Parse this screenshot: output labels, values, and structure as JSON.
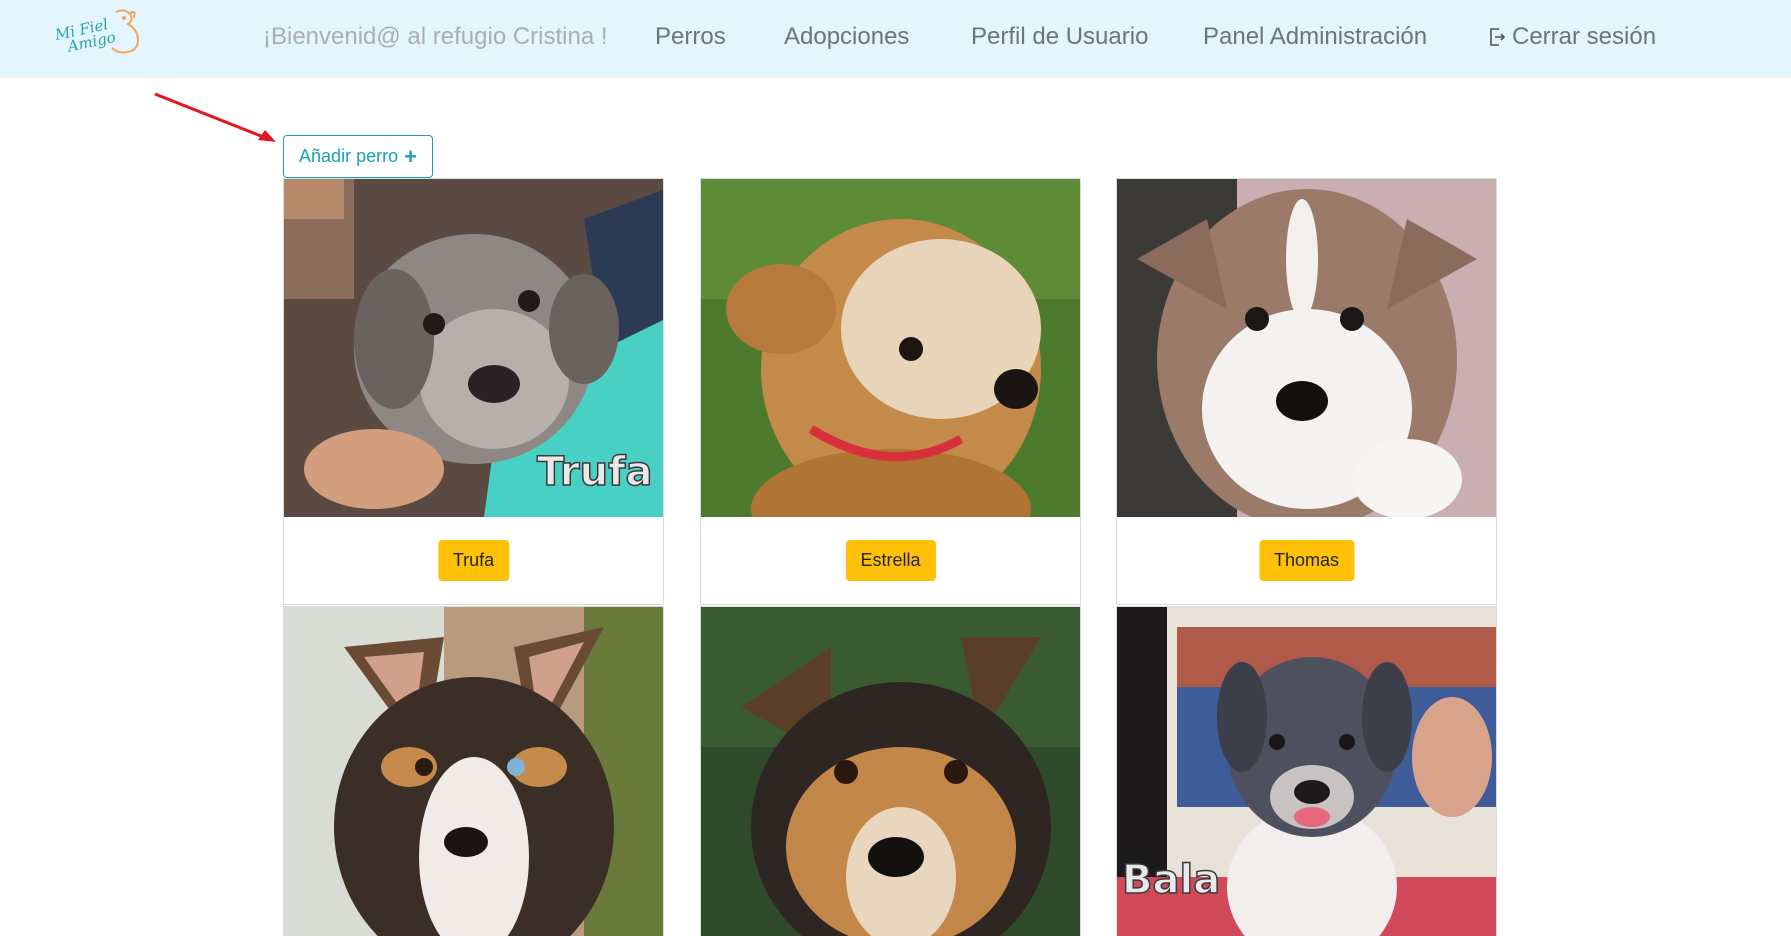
{
  "nav": {
    "logo_line1": "Mi Fiel",
    "logo_line2": "Amigo",
    "welcome": "¡Bienvenid@ al refugio Cristina !",
    "links": {
      "perros": "Perros",
      "adopciones": "Adopciones",
      "perfil": "Perfil de Usuario",
      "panel": "Panel Administración",
      "logout": "Cerrar sesión"
    }
  },
  "add_button": {
    "label": "Añadir perro",
    "icon": "plus-icon"
  },
  "annotation": {
    "arrow_color": "#e3161d"
  },
  "dogs": [
    {
      "name": "Trufa",
      "photo_caption": "Trufa"
    },
    {
      "name": "Estrella",
      "photo_caption": ""
    },
    {
      "name": "Thomas",
      "photo_caption": ""
    },
    {
      "name": "",
      "photo_caption": ""
    },
    {
      "name": "",
      "photo_caption": ""
    },
    {
      "name": "",
      "photo_caption": "Bala"
    }
  ],
  "colors": {
    "navbar_bg": "#e3f5fd",
    "accent": "#17a2b8",
    "name_button": "#ffc107"
  }
}
